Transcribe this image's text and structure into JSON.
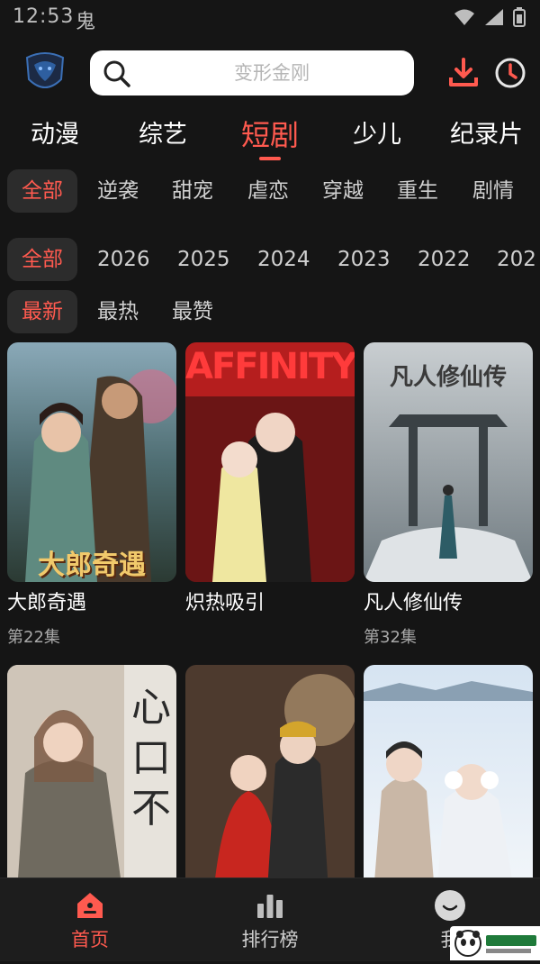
{
  "status": {
    "time": "12:53",
    "ghost": "鬼"
  },
  "header": {
    "search_placeholder": "变形金刚"
  },
  "categories": [
    {
      "label": "动漫"
    },
    {
      "label": "综艺"
    },
    {
      "label": "短剧",
      "active": true
    },
    {
      "label": "少儿"
    },
    {
      "label": "纪录片"
    }
  ],
  "genres": [
    "全部",
    "逆袭",
    "甜宠",
    "虐恋",
    "穿越",
    "重生",
    "剧情"
  ],
  "years": [
    "全部",
    "2026",
    "2025",
    "2024",
    "2023",
    "2022",
    "202"
  ],
  "sorts": [
    "最新",
    "最热",
    "最赞"
  ],
  "cards": [
    {
      "title": "大郎奇遇",
      "episode": "第22集",
      "poster_text": "大郎奇遇"
    },
    {
      "title": "炽热吸引",
      "episode": "",
      "poster_text": "AFFINITY"
    },
    {
      "title": "凡人修仙传",
      "episode": "第32集",
      "poster_text": "凡人修仙传"
    },
    {
      "title": "",
      "episode": "",
      "poster_text": "心口不"
    },
    {
      "title": "",
      "episode": "",
      "poster_text": ""
    },
    {
      "title": "",
      "episode": "",
      "poster_text": ""
    }
  ],
  "bottom_nav": [
    {
      "label": "首页",
      "icon": "home-icon",
      "active": true
    },
    {
      "label": "排行榜",
      "icon": "ranking-icon"
    },
    {
      "label": "我",
      "icon": "profile-icon"
    }
  ],
  "colors": {
    "accent": "#ff5a4f",
    "background": "#151515",
    "chip_bg": "#2c2c2c"
  }
}
